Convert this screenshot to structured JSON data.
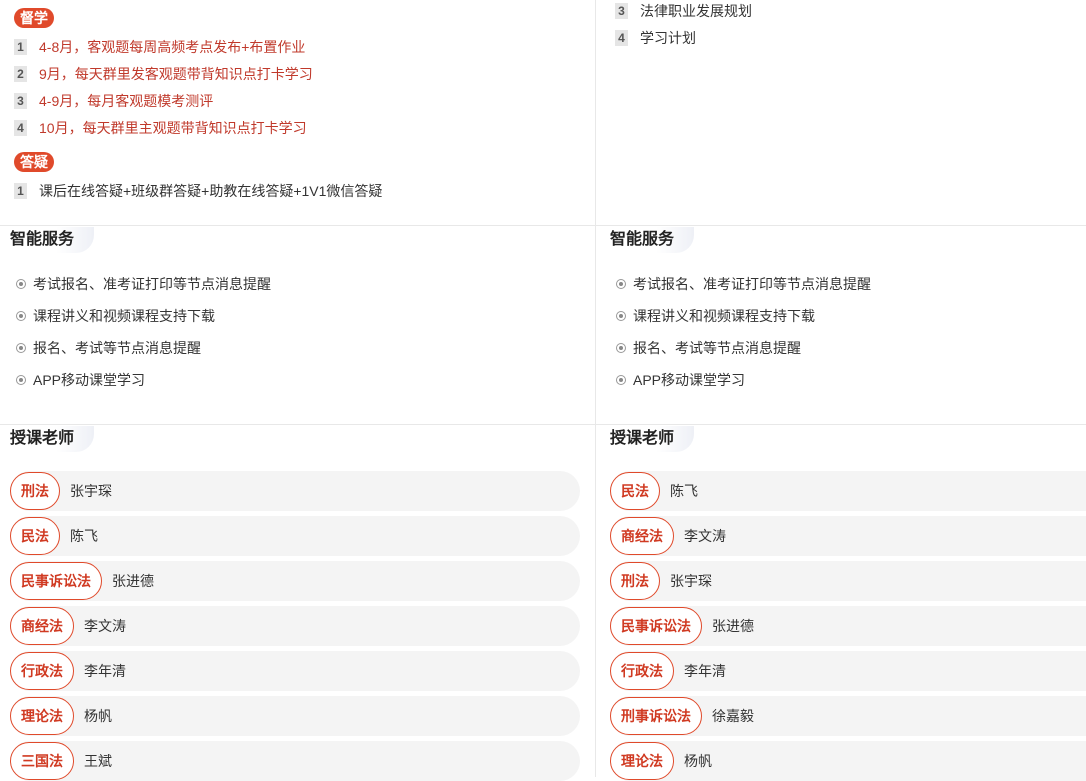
{
  "left": {
    "supervise": {
      "tag": "督学",
      "items": [
        {
          "num": "1",
          "text": "4-8月，客观题每周高频考点发布+布置作业"
        },
        {
          "num": "2",
          "text": "9月，每天群里发客观题带背知识点打卡学习"
        },
        {
          "num": "3",
          "text": "4-9月，每月客观题模考测评"
        },
        {
          "num": "4",
          "text": "10月，每天群里主观题带背知识点打卡学习"
        }
      ]
    },
    "qa": {
      "tag": "答疑",
      "items": [
        {
          "num": "1",
          "text": "课后在线答疑+班级群答疑+助教在线答疑+1V1微信答疑"
        }
      ]
    },
    "smart_service": {
      "title": "智能服务",
      "items": [
        "考试报名、准考证打印等节点消息提醒",
        "课程讲义和视频课程支持下载",
        "报名、考试等节点消息提醒",
        "APP移动课堂学习"
      ]
    },
    "teachers": {
      "title": "授课老师",
      "rows": [
        {
          "subject": "刑法",
          "name": "张宇琛"
        },
        {
          "subject": "民法",
          "name": "陈飞"
        },
        {
          "subject": "民事诉讼法",
          "name": "张进德"
        },
        {
          "subject": "商经法",
          "name": "李文涛"
        },
        {
          "subject": "行政法",
          "name": "李年清"
        },
        {
          "subject": "理论法",
          "name": "杨帆"
        },
        {
          "subject": "三国法",
          "name": "王斌"
        }
      ]
    }
  },
  "right": {
    "top_items": [
      {
        "num": "3",
        "text": "法律职业发展规划"
      },
      {
        "num": "4",
        "text": "学习计划"
      }
    ],
    "smart_service": {
      "title": "智能服务",
      "items": [
        "考试报名、准考证打印等节点消息提醒",
        "课程讲义和视频课程支持下载",
        "报名、考试等节点消息提醒",
        "APP移动课堂学习"
      ]
    },
    "teachers": {
      "title": "授课老师",
      "rows": [
        {
          "subject": "民法",
          "name": "陈飞"
        },
        {
          "subject": "商经法",
          "name": "李文涛"
        },
        {
          "subject": "刑法",
          "name": "张宇琛"
        },
        {
          "subject": "民事诉讼法",
          "name": "张进德"
        },
        {
          "subject": "行政法",
          "name": "李年清"
        },
        {
          "subject": "刑事诉讼法",
          "name": "徐嘉毅"
        },
        {
          "subject": "理论法",
          "name": "杨帆"
        }
      ]
    }
  },
  "colors": {
    "accent": "#e04a2b",
    "subject_text": "#d03a22",
    "highlight_text": "#c0392b"
  }
}
